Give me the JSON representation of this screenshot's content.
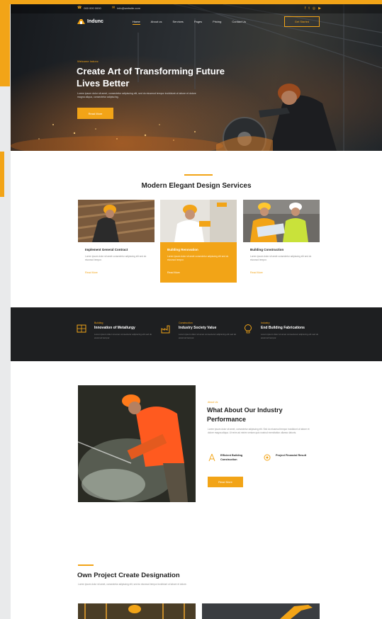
{
  "colors": {
    "accent": "#f2a417",
    "dark": "#1e1f21",
    "text": "#222222"
  },
  "topbar": {
    "phone": "000 000 0000",
    "email": "info@website.com",
    "social_icons": [
      "facebook-icon",
      "twitter-icon",
      "instagram-icon",
      "youtube-icon"
    ]
  },
  "nav": {
    "logo": {
      "icon": "crane-icon",
      "name": "Indunc"
    },
    "items": [
      "Home",
      "About us",
      "Services",
      "Pages",
      "Pricing",
      "Contact Us"
    ],
    "active": "Home",
    "cta": "Get Started"
  },
  "hero": {
    "eyebrow": "Welcome Indunc",
    "title": "Create Art of Transforming Future Lives Better",
    "text": "Lorem ipsum dolor sit amet, consectetur adipiscing elit, sed do eiusmod tempor incididunt ut labore et dolore magna aliqua, consectetur adipiscing.",
    "button": "Read More"
  },
  "services": {
    "title": "Modern Elegant Design Services",
    "cards": [
      {
        "name": "Implement General Contract",
        "desc": "Lorem ipsum dolor sit amet consectetur adipiscing elit sed do eiusmod tempor.",
        "link": "Read More"
      },
      {
        "name": "Building Renovation",
        "desc": "Lorem ipsum dolor sit amet consectetur adipiscing elit sed do eiusmod tempor.",
        "link": "Read More"
      },
      {
        "name": "Building Construction",
        "desc": "Lorem ipsum dolor sit amet consectetur adipiscing elit sed do eiusmod tempor.",
        "link": "Read More"
      }
    ]
  },
  "features": [
    {
      "icon": "blueprint-icon",
      "eyebrow": "Building",
      "title": "Innovation of Metallurgy",
      "desc": "Lorem ipsum dolor sit amet consectetur adipiscing elit sed do eiusmod tempor."
    },
    {
      "icon": "factory-icon",
      "eyebrow": "Construction",
      "title": "Industry Society Value",
      "desc": "Lorem ipsum dolor sit amet consectetur adipiscing elit sed do eiusmod tempor."
    },
    {
      "icon": "lightbulb-icon",
      "eyebrow": "Industry",
      "title": "End Building Fabrications",
      "desc": "Lorem ipsum dolor sit amet consectetur adipiscing elit sed do eiusmod tempor."
    }
  ],
  "about": {
    "eyebrow": "About Us",
    "title": "What About Our Industry Performance",
    "text": "Lorem ipsum dolor sit amet, consectetur adipiscing elit. Sed do eiusmod tempor incididunt ut labore et dolore magna aliqua. Ut enim ad minim veniam quis nostrud exercitation ullamco laboris.",
    "points": [
      {
        "icon": "compass-icon",
        "label": "Efficient Building Construction"
      },
      {
        "icon": "gear-icon",
        "label": "Project Financial Result"
      }
    ],
    "button": "Read More"
  },
  "projects": {
    "title": "Own Project Create Designation",
    "text": "Lorem ipsum dolor sit amet, consectetur adipiscing elit, sed do eiusmod tempor incididunt ut labore et dolore."
  }
}
